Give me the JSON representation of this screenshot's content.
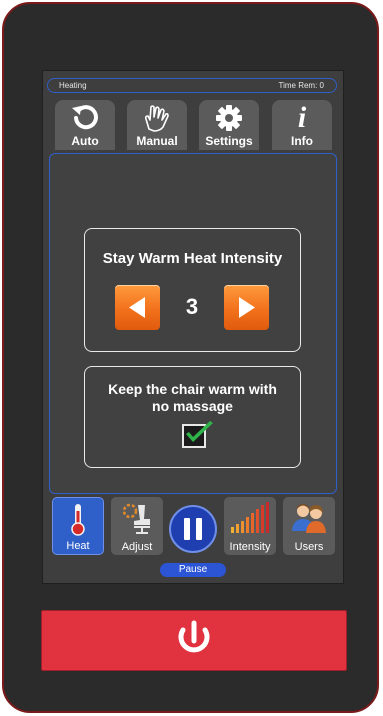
{
  "status": {
    "left": "Heating",
    "right": "Time Rem: 0"
  },
  "tabs": [
    {
      "label": "Auto",
      "icon": "refresh-icon"
    },
    {
      "label": "Manual",
      "icon": "hand-icon"
    },
    {
      "label": "Settings",
      "icon": "gear-icon"
    },
    {
      "label": "Info",
      "icon": "info-icon"
    }
  ],
  "intensity_card": {
    "title": "Stay Warm Heat Intensity",
    "value": "3"
  },
  "warm_card": {
    "line1": "Keep the chair warm with",
    "line2": "no massage",
    "checked": true
  },
  "bottom_tabs": [
    {
      "label": "Heat",
      "icon": "thermometer-icon",
      "active": true
    },
    {
      "label": "Adjust",
      "icon": "chair-icon"
    },
    {
      "label": "Intensity",
      "icon": "bars-icon"
    },
    {
      "label": "Users",
      "icon": "users-icon"
    }
  ],
  "pause_label": "Pause",
  "colors": {
    "accent_blue": "#2f5fc8",
    "orange": "#f2711c",
    "power_red": "#e0323f",
    "check_green": "#2fb34a"
  }
}
